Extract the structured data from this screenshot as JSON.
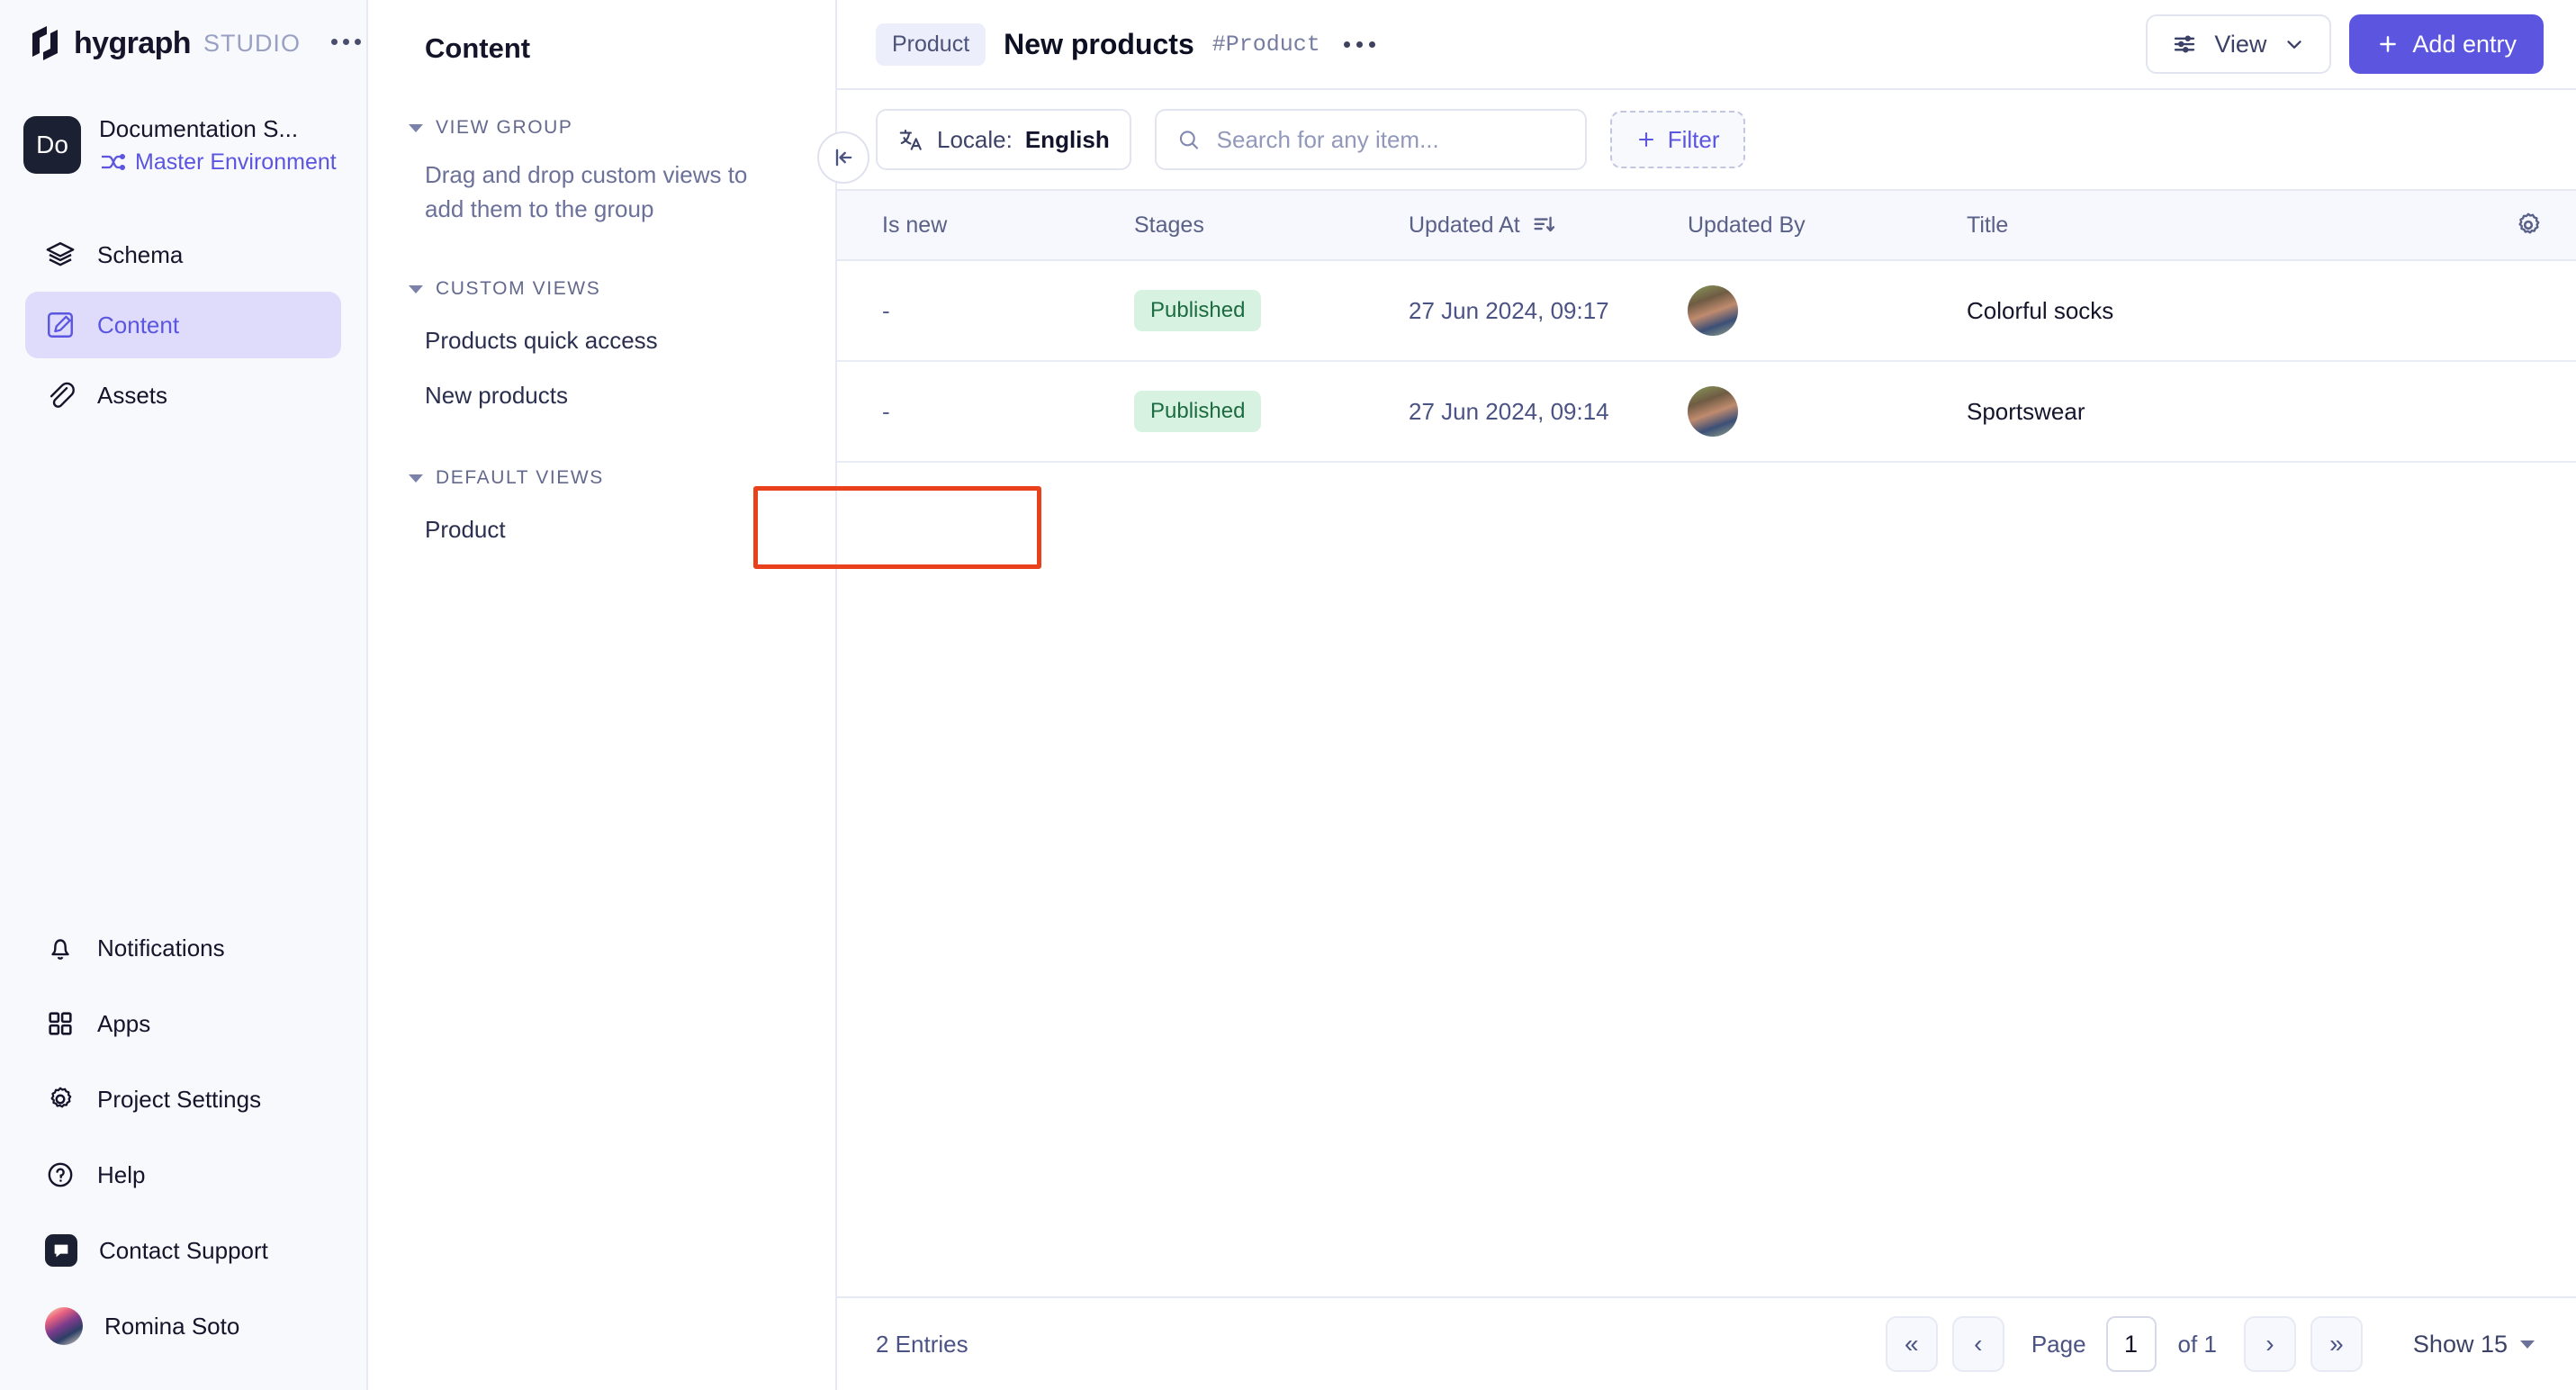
{
  "brand": {
    "name": "hygraph",
    "sub": "STUDIO",
    "menu_icon": "ellipsis-icon"
  },
  "project": {
    "avatar_initials": "Do",
    "name": "Documentation S...",
    "environment": "Master Environment"
  },
  "sidebar": {
    "items": [
      {
        "label": "Schema",
        "icon": "layers-icon",
        "active": false
      },
      {
        "label": "Content",
        "icon": "edit-square-icon",
        "active": true
      },
      {
        "label": "Assets",
        "icon": "paperclip-icon",
        "active": false
      }
    ],
    "bottom_items": [
      {
        "label": "Notifications",
        "icon": "bell-icon"
      },
      {
        "label": "Apps",
        "icon": "grid-icon"
      },
      {
        "label": "Project Settings",
        "icon": "gear-icon"
      },
      {
        "label": "Help",
        "icon": "question-circle-icon"
      },
      {
        "label": "Contact Support",
        "icon": "chat-bubble-icon"
      },
      {
        "label": "Romina Soto",
        "icon": "user-avatar"
      }
    ]
  },
  "views_panel": {
    "title": "Content",
    "groups": [
      {
        "heading": "VIEW GROUP",
        "help_text": "Drag and drop custom views to add them to the group",
        "items": []
      },
      {
        "heading": "CUSTOM VIEWS",
        "items": [
          "Products quick access",
          "New products"
        ]
      },
      {
        "heading": "DEFAULT VIEWS",
        "items": [
          "Product"
        ],
        "highlighted": true
      }
    ],
    "collapse_icon": "collapse-left-icon",
    "highlight_color": "#e8411c"
  },
  "header": {
    "chip": "Product",
    "title": "New products",
    "hashtag": "#Product",
    "more_icon": "ellipsis-icon",
    "view_button": "View",
    "add_entry_button": "Add entry",
    "accent_color": "#5b55e0"
  },
  "toolbar": {
    "locale_label": "Locale:",
    "locale_value": "English",
    "locale_icon": "translate-icon",
    "search_placeholder": "Search for any item...",
    "search_value": "",
    "search_icon": "search-icon",
    "filter_button": "Filter"
  },
  "table": {
    "columns": [
      "Is new",
      "Stages",
      "Updated At",
      "Updated By",
      "Title"
    ],
    "sort_column": "Updated At",
    "sort_icon": "sort-descending-icon",
    "settings_icon": "gear-icon",
    "rows": [
      {
        "is_new": "-",
        "stage": "Published",
        "updated_at": "27 Jun 2024, 09:17",
        "updated_by": "avatar",
        "title": "Colorful socks"
      },
      {
        "is_new": "-",
        "stage": "Published",
        "updated_at": "27 Jun 2024, 09:14",
        "updated_by": "avatar",
        "title": "Sportswear"
      }
    ],
    "published_badge_bg": "#d7f2e1",
    "published_badge_color": "#1d6b41"
  },
  "pagination": {
    "entries": "2 Entries",
    "first_icon": "«",
    "prev_icon": "‹",
    "page_label": "Page",
    "page_value": "1",
    "of_label": "of 1",
    "next_icon": "›",
    "last_icon": "»",
    "show_label": "Show 15"
  }
}
